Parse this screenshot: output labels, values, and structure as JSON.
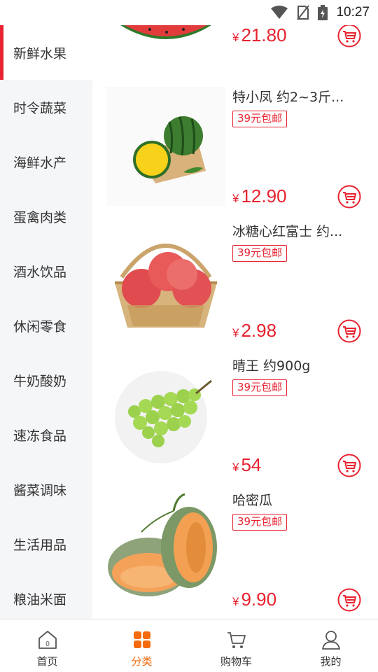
{
  "status_bar": {
    "time": "10:27"
  },
  "sidebar": {
    "items": [
      {
        "label": "新鲜水果"
      },
      {
        "label": "时令蔬菜"
      },
      {
        "label": "海鲜水产"
      },
      {
        "label": "蛋禽肉类"
      },
      {
        "label": "酒水饮品"
      },
      {
        "label": "休闲零食"
      },
      {
        "label": "牛奶酸奶"
      },
      {
        "label": "速冻食品"
      },
      {
        "label": "酱菜调味"
      },
      {
        "label": "生活用品"
      },
      {
        "label": "粮油米面"
      }
    ],
    "active_index": 0
  },
  "products": [
    {
      "name": "",
      "badge": "",
      "currency": "¥",
      "price": "21.80",
      "image": "watermelon-slice"
    },
    {
      "name": "特小凤 约2~3斤...",
      "badge": "39元包邮",
      "currency": "¥",
      "price": "12.90",
      "image": "yellow-watermelon"
    },
    {
      "name": "冰糖心红富士 约...",
      "badge": "39元包邮",
      "currency": "¥",
      "price": "2.98",
      "image": "apples-basket"
    },
    {
      "name": "晴王 约900g",
      "badge": "39元包邮",
      "currency": "¥",
      "price": "54",
      "image": "green-grapes"
    },
    {
      "name": "哈密瓜",
      "badge": "39元包邮",
      "currency": "¥",
      "price": "9.90",
      "image": "hami-melon"
    }
  ],
  "tabbar": {
    "items": [
      {
        "label": "首页",
        "icon": "home-icon"
      },
      {
        "label": "分类",
        "icon": "category-icon"
      },
      {
        "label": "购物车",
        "icon": "cart-icon"
      },
      {
        "label": "我的",
        "icon": "user-icon"
      }
    ],
    "active_index": 1
  },
  "colors": {
    "accent_red": "#e8222f",
    "tab_active": "#f46a0c",
    "sidebar_bg": "#f5f6f8"
  }
}
